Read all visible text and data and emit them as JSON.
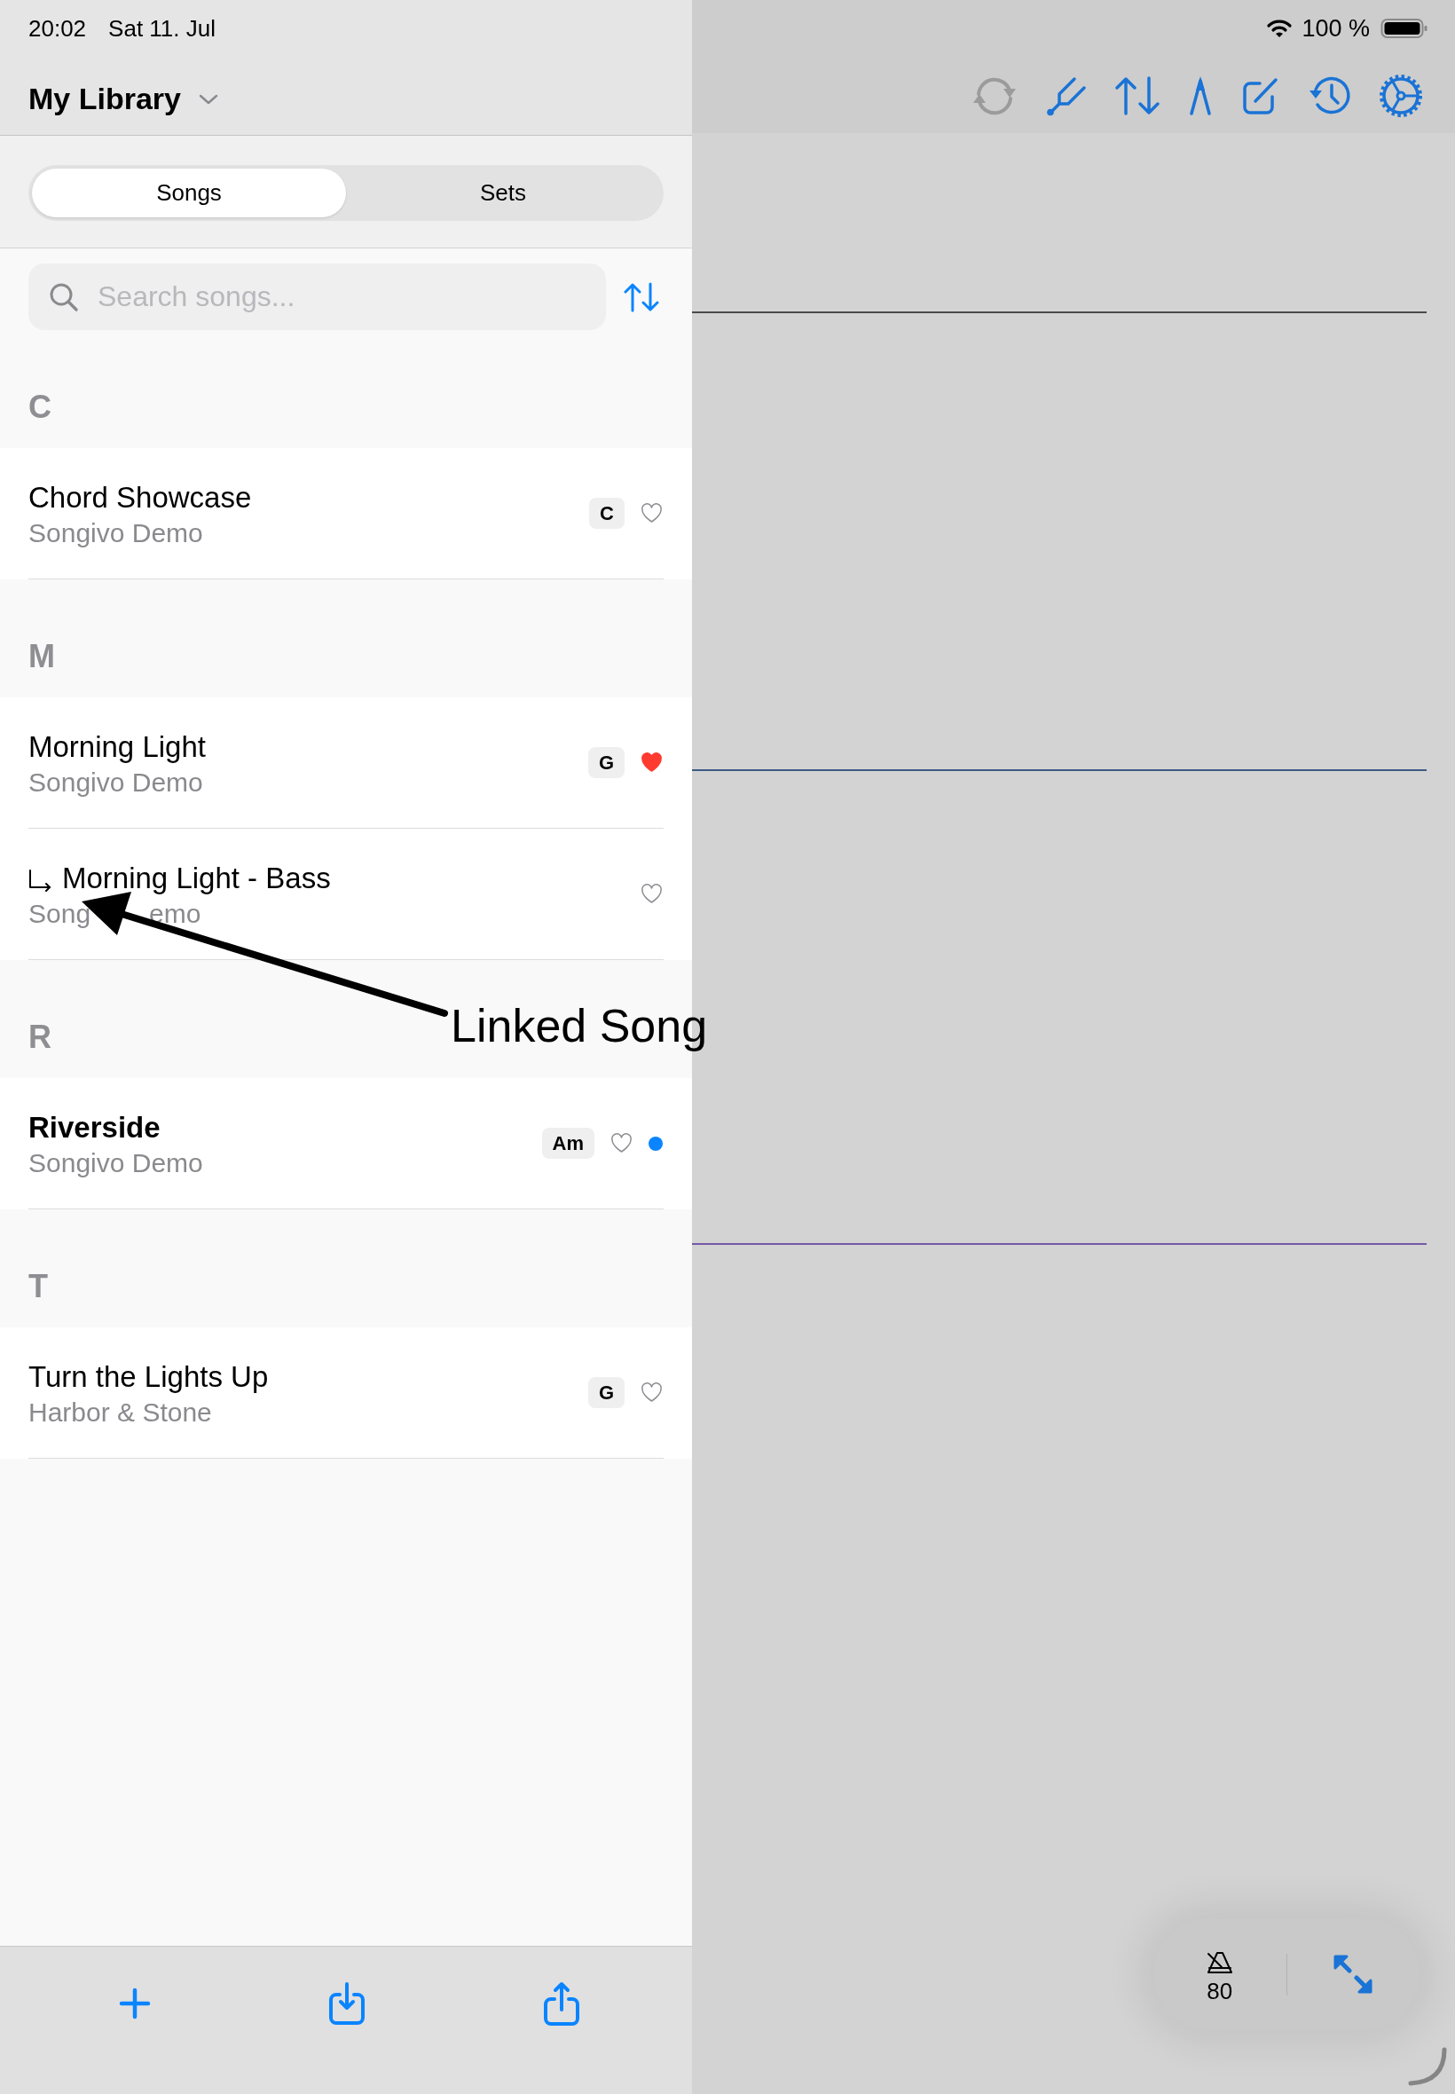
{
  "status_bar": {
    "time": "20:02",
    "date": "Sat 11. Jul",
    "battery": "100 %"
  },
  "sidebar": {
    "title": "My Library",
    "tabs": [
      {
        "label": "Songs",
        "selected": true
      },
      {
        "label": "Sets",
        "selected": false
      }
    ],
    "search": {
      "placeholder": "Search songs..."
    },
    "sections": [
      {
        "letter": "C",
        "songs": [
          {
            "title": "Chord Showcase",
            "artist": "Songivo Demo",
            "key": "C",
            "favorite": false,
            "linked": false,
            "new": false
          }
        ]
      },
      {
        "letter": "M",
        "songs": [
          {
            "title": "Morning Light",
            "artist": "Songivo Demo",
            "key": "G",
            "favorite": true,
            "linked": false,
            "new": false
          },
          {
            "title": "Morning Light - Bass",
            "artist": "Song",
            "artist_tail": "emo",
            "favorite": false,
            "linked": true,
            "new": false
          }
        ]
      },
      {
        "letter": "R",
        "songs": [
          {
            "title": "Riverside",
            "artist": "Songivo Demo",
            "key": "Am",
            "favorite": false,
            "linked": false,
            "new": true
          }
        ]
      },
      {
        "letter": "T",
        "songs": [
          {
            "title": "Turn the Lights Up",
            "artist": "Harbor & Stone",
            "key": "G",
            "favorite": false,
            "linked": false,
            "new": false
          }
        ]
      }
    ],
    "bottom_toolbar": [
      {
        "kind": "add"
      },
      {
        "kind": "import"
      },
      {
        "kind": "share"
      }
    ]
  },
  "toolbar": [
    {
      "kind": "sync",
      "disabled": true
    },
    {
      "kind": "tuner",
      "disabled": false
    },
    {
      "kind": "transpose",
      "disabled": false
    },
    {
      "kind": "compass",
      "disabled": false
    },
    {
      "kind": "compose",
      "disabled": false
    },
    {
      "kind": "history",
      "disabled": false
    },
    {
      "kind": "settings",
      "disabled": false
    }
  ],
  "metronome": {
    "tempo": "80"
  },
  "annotation": {
    "text": "Linked Song"
  }
}
